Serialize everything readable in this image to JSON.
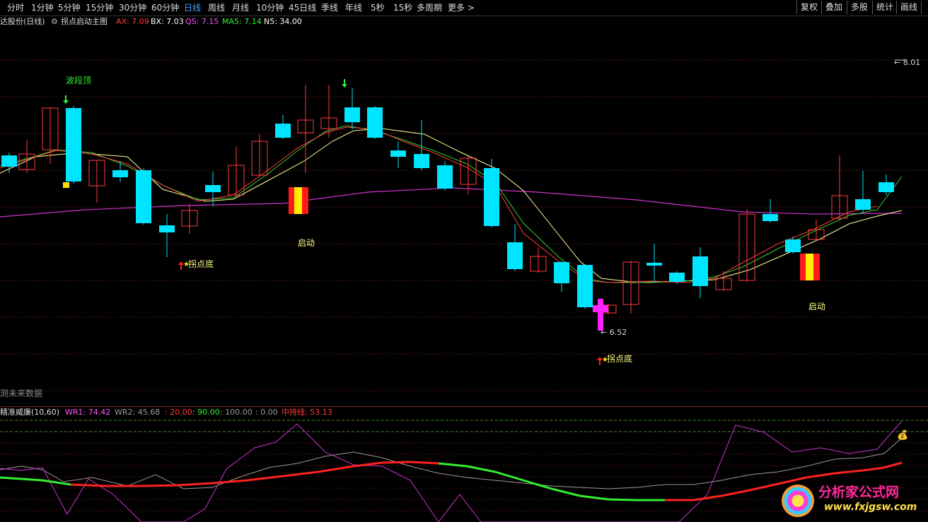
{
  "toolbar": {
    "periods": [
      "分时",
      "1分钟",
      "5分钟",
      "15分钟",
      "30分钟",
      "60分钟",
      "日线",
      "周线",
      "月线",
      "10分钟",
      "45日线",
      "季线",
      "年线",
      "5秒",
      "15秒",
      "多周期",
      "更多 >"
    ],
    "active_period": "日线",
    "tools": [
      "复权",
      "叠加",
      "多股",
      "统计",
      "画线"
    ]
  },
  "main_header": {
    "stock": "达股份(日线)",
    "indicator_name": "拐点启动主图",
    "ax_label": "AX: 7.09",
    "bx_label": "BX: 7.03",
    "qs_label": "QS: 7.15",
    "ma5_label": "MA5: 7.14",
    "n5_label": "N5: 34.00"
  },
  "annotations": {
    "wave_top": "波段顶",
    "launch1": "启动",
    "launch2": "启动",
    "turn_bottom1": "拐点底",
    "turn_bottom2": "拐点底",
    "low_price": "6.52",
    "high_price": "8.01",
    "future_data": "测未来数据"
  },
  "indicator_header": {
    "name": "精准威廉(10,60)",
    "wr1": "WR1: 74.42",
    "wr2": "WR2: 45.68",
    "v20": ": 20.00",
    "v90": ": 90.00",
    "v100": ": 100.00",
    "v0": ": 0.00",
    "mid": "中持线: 53.13"
  },
  "watermark": {
    "title": "分析家公式网",
    "url": "www.fxjgsw.com"
  },
  "colors": {
    "up_candle": "#ff3b3b",
    "down_candle": "#00e5ff",
    "ma_white": "#ffff99",
    "ma_red": "#ff3b3b",
    "ma_green": "#33cc33",
    "ma_purple": "#cc33cc",
    "wr1": "#cc33cc",
    "wr2": "#9a9a9a",
    "mid_up": "#ff2020",
    "mid_down": "#33ee33"
  }
}
